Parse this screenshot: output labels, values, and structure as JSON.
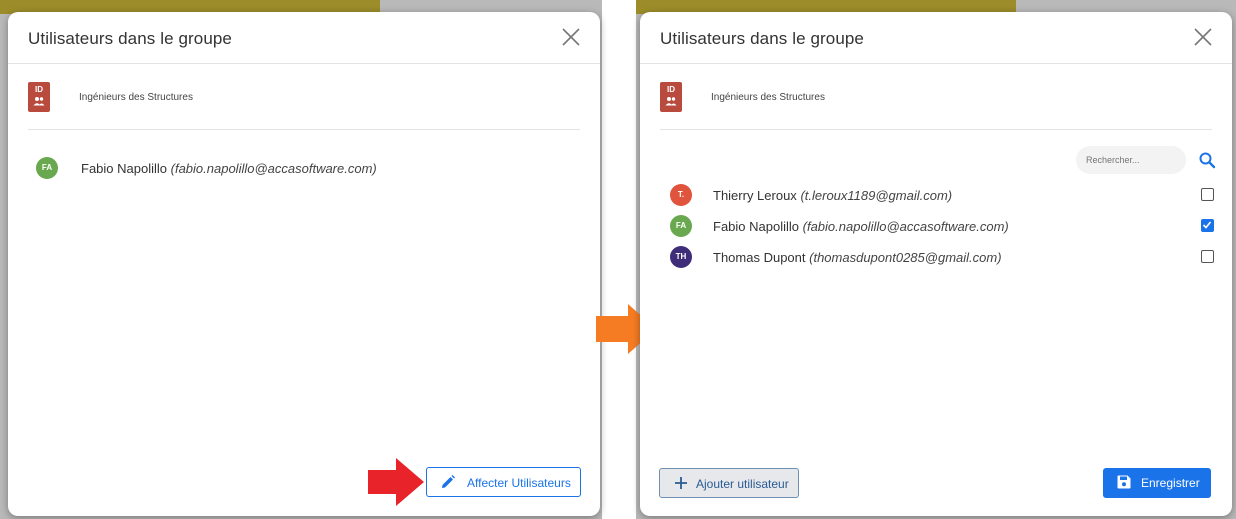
{
  "left_dialog": {
    "title": "Utilisateurs dans le groupe",
    "group": {
      "badge": "ID",
      "name": "Ingénieurs des Structures",
      "color": "#b84a3e"
    },
    "users": [
      {
        "initials": "FA",
        "name": "Fabio Napolillo",
        "email": "(fabio.napolillo@accasoftware.com)",
        "color": "#6aa84f"
      }
    ],
    "assign_button": "Affecter Utilisateurs"
  },
  "right_dialog": {
    "title": "Utilisateurs dans le groupe",
    "group": {
      "badge": "ID",
      "name": "Ingénieurs des Structures",
      "color": "#b84a3e"
    },
    "search": {
      "placeholder": "Rechercher..."
    },
    "users": [
      {
        "initials": "T.",
        "name": "Thierry Leroux",
        "email": "(t.leroux1189@gmail.com)",
        "color": "#e0533d",
        "checked": false
      },
      {
        "initials": "FA",
        "name": "Fabio Napolillo",
        "email": "(fabio.napolillo@accasoftware.com)",
        "color": "#6aa84f",
        "checked": true
      },
      {
        "initials": "TH",
        "name": "Thomas Dupont",
        "email": "(thomasdupont0285@gmail.com)",
        "color": "#3f2d7a",
        "checked": false
      }
    ],
    "add_button": "Ajouter utilisateur",
    "save_button": "Enregistrer"
  },
  "colors": {
    "accent": "#1a73e8",
    "red_arrow": "#e8242a",
    "orange_arrow": "#f57c23"
  },
  "icons": {
    "close": "close-icon",
    "group": "people-icon",
    "edit": "pencil-icon",
    "search": "search-icon",
    "add": "plus-icon",
    "save": "floppy-disk-icon"
  }
}
